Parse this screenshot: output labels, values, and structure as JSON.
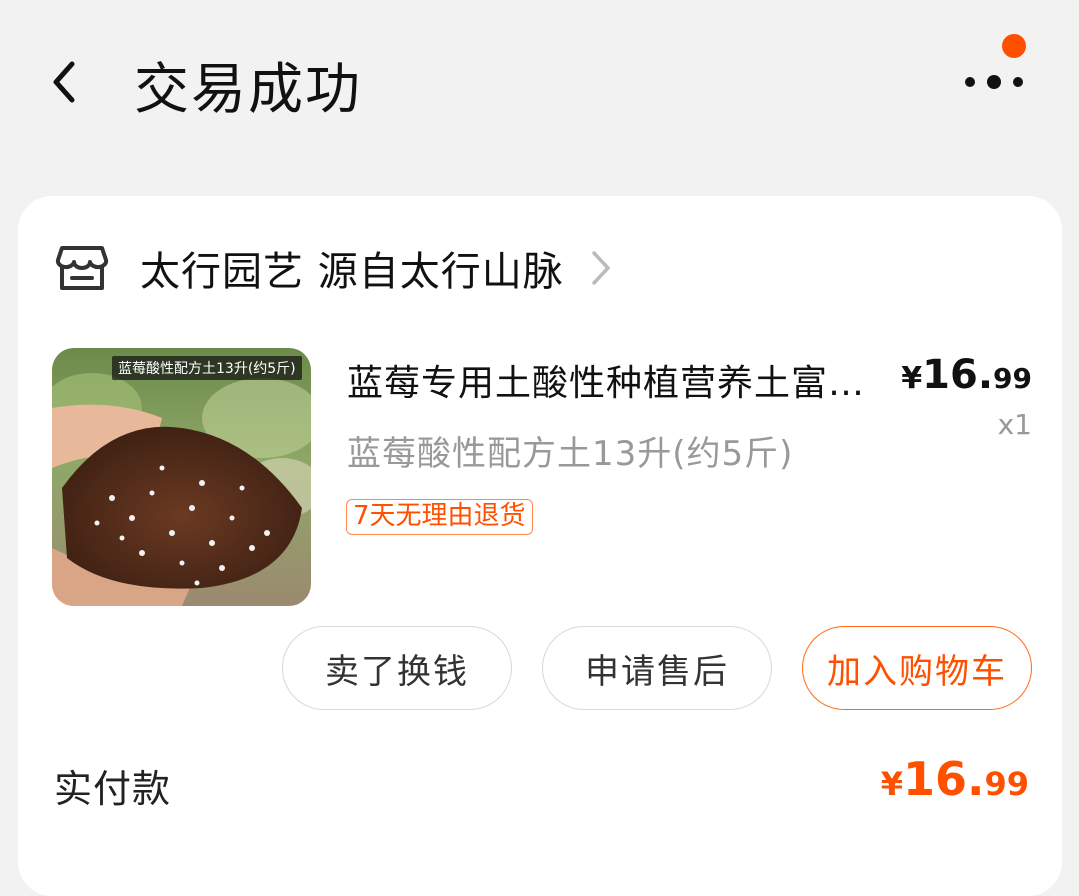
{
  "nav": {
    "title": "交易成功",
    "back_icon": "chevron-left-icon",
    "more_icon": "more-dots-icon",
    "notification_dot_color": "#ff5000"
  },
  "order": {
    "shop": {
      "icon": "store-icon",
      "name": "太行园艺 源自太行山脉"
    },
    "product": {
      "image_caption": "蓝莓酸性配方土13升(约5斤)",
      "title": "蓝莓专用土酸性种植营养土富含泥炭土壤",
      "sku": "蓝莓酸性配方土13升(约5斤)",
      "price_currency": "¥",
      "price_int": "16.",
      "price_dec": "99",
      "quantity": "x1",
      "tag": "7天无理由退货"
    },
    "actions": {
      "sell_label": "卖了换钱",
      "aftersale_label": "申请售后",
      "cart_label": "加入购物车"
    },
    "payment": {
      "label": "实付款",
      "currency": "¥",
      "amount_int": "16.",
      "amount_dec": "99"
    }
  },
  "colors": {
    "accent": "#ff5000",
    "background": "#f2f2f2",
    "card": "#ffffff"
  }
}
